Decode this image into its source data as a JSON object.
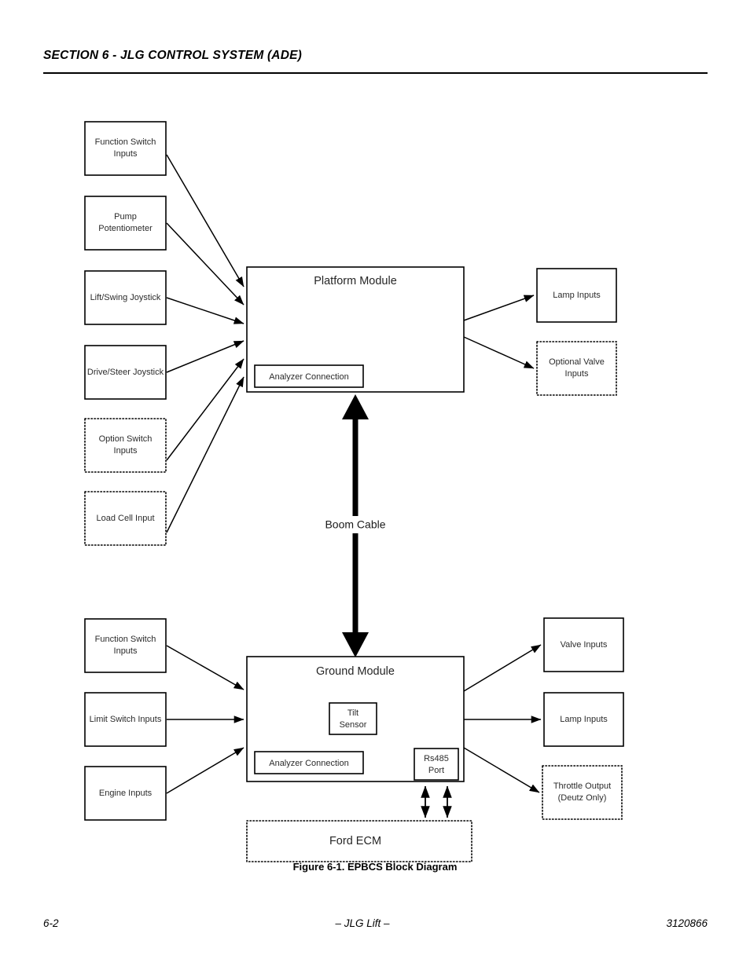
{
  "header": {
    "section_title": "SECTION 6 - JLG CONTROL SYSTEM (ADE)"
  },
  "figure": {
    "caption": "Figure 6-1.  EPBCS Block Diagram",
    "boom_cable_label": "Boom Cable"
  },
  "footer": {
    "page_number": "6-2",
    "center_text": "– JLG Lift –",
    "document_number": "3120866"
  },
  "modules": {
    "platform": {
      "title": "Platform Module",
      "analyzer_connection": "Analyzer Connection"
    },
    "ground": {
      "title": "Ground Module",
      "tilt_sensor": "Tilt\nSensor",
      "tilt_sensor_line1": "Tilt",
      "tilt_sensor_line2": "Sensor",
      "analyzer_connection": "Analyzer Connection",
      "rs485_line1": "Rs485",
      "rs485_line2": "Port"
    },
    "ford_ecm": {
      "title": "Ford ECM"
    }
  },
  "platform_inputs": [
    {
      "id": "function-switch-inputs-top",
      "line1": "Function Switch",
      "line2": "Inputs",
      "border": "solid"
    },
    {
      "id": "pump-potentiometer",
      "line1": "Pump",
      "line2": "Potentiometer",
      "border": "solid"
    },
    {
      "id": "lift-swing-joystick",
      "line1": "Lift/Swing Joystick",
      "line2": "",
      "border": "solid"
    },
    {
      "id": "drive-steer-joystick",
      "line1": "Drive/Steer Joystick",
      "line2": "",
      "border": "solid"
    },
    {
      "id": "option-switch-inputs",
      "line1": "Option Switch",
      "line2": "Inputs",
      "border": "dotted"
    },
    {
      "id": "load-cell-input",
      "line1": "Load Cell Input",
      "line2": "",
      "border": "dotted"
    }
  ],
  "platform_outputs": [
    {
      "id": "lamp-inputs-platform",
      "line1": "Lamp Inputs",
      "line2": "",
      "border": "solid"
    },
    {
      "id": "optional-valve-inputs",
      "line1": "Optional Valve",
      "line2": "Inputs",
      "border": "dotted"
    }
  ],
  "ground_inputs": [
    {
      "id": "function-switch-inputs-bottom",
      "line1": "Function Switch",
      "line2": "Inputs",
      "border": "solid"
    },
    {
      "id": "limit-switch-inputs",
      "line1": "Limit Switch Inputs",
      "line2": "",
      "border": "solid"
    },
    {
      "id": "engine-inputs",
      "line1": "Engine Inputs",
      "line2": "",
      "border": "solid"
    }
  ],
  "ground_outputs": [
    {
      "id": "valve-inputs",
      "line1": "Valve Inputs",
      "line2": "",
      "border": "solid"
    },
    {
      "id": "lamp-inputs-ground",
      "line1": "Lamp Inputs",
      "line2": "",
      "border": "solid"
    },
    {
      "id": "throttle-output",
      "line1": "Throttle Output",
      "line2": "(Deutz Only)",
      "border": "dotted"
    }
  ],
  "colors": {
    "ink": "#000000",
    "text": "#2b2b2b",
    "paper": "#ffffff"
  }
}
